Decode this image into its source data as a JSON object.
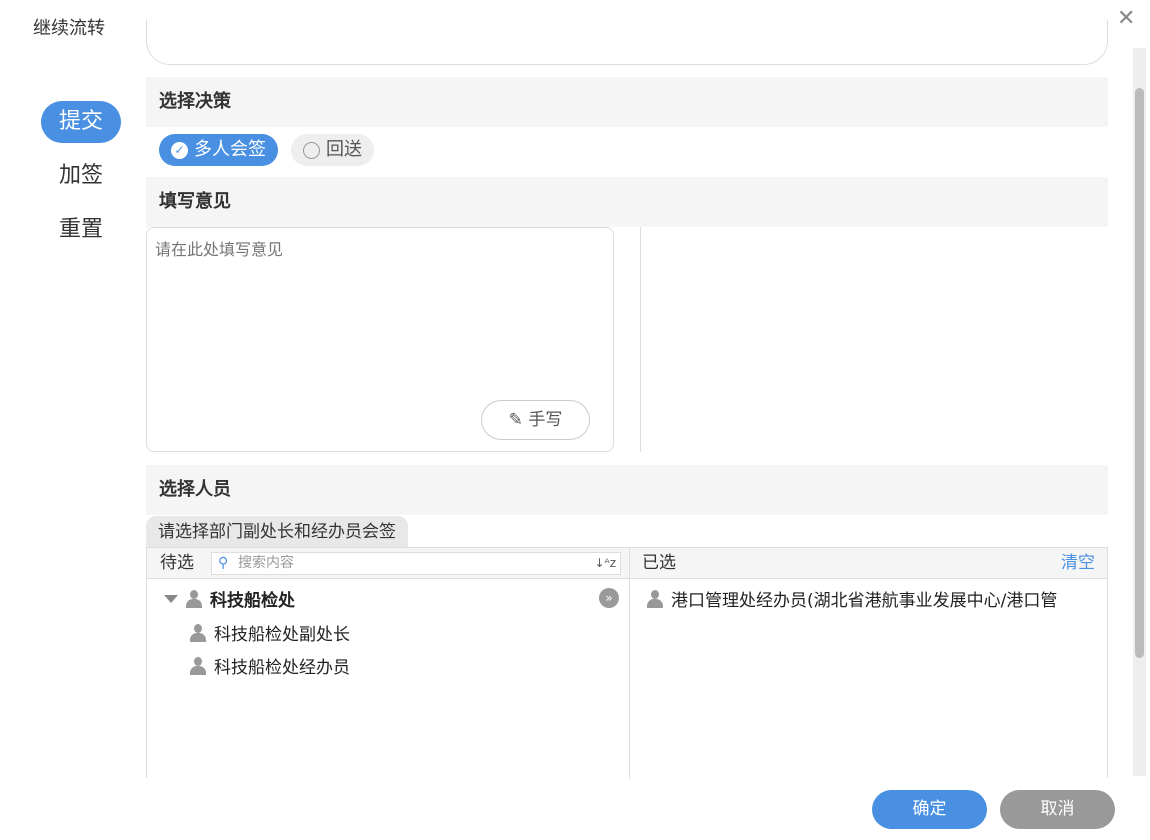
{
  "dialog": {
    "title": "继续流转",
    "close_icon": "close-icon"
  },
  "side_nav": [
    "提交",
    "加签",
    "重置"
  ],
  "decision": {
    "heading": "选择决策",
    "options": [
      {
        "label": "多人会签",
        "selected": true
      },
      {
        "label": "回送",
        "selected": false
      }
    ]
  },
  "opinion": {
    "heading": "填写意见",
    "placeholder": "请在此处填写意见",
    "handwrite_label": "✎ 手写"
  },
  "people": {
    "heading": "选择人员",
    "tab": "请选择部门副处长和经办员会签",
    "pending_label": "待选",
    "search_placeholder": "搜索内容",
    "selected_label": "已选",
    "clear_label": "清空",
    "tree": {
      "group": "科技船检处",
      "members": [
        "科技船检处副处长",
        "科技船检处经办员"
      ]
    },
    "selected": [
      "港口管理处经办员(湖北省港航事业发展中心/港口管"
    ]
  },
  "footer": {
    "ok": "确定",
    "cancel": "取消"
  }
}
